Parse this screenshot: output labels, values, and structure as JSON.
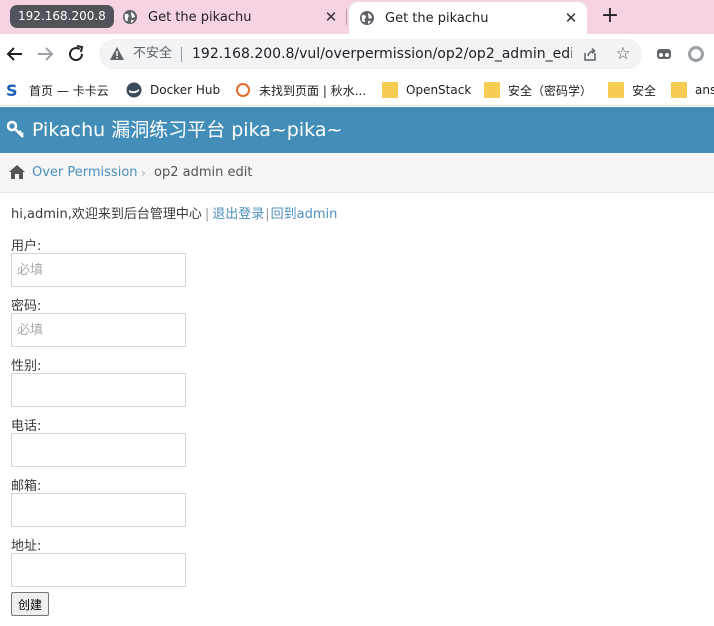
{
  "browser": {
    "tab_group_label": "192.168.200.8",
    "tabs": [
      {
        "title": "Get the pikachu",
        "active": false
      },
      {
        "title": "Get the pikachu",
        "active": true
      }
    ],
    "new_tab_icon": "plus-icon",
    "omnibox": {
      "security_label": "不安全",
      "url": "192.168.200.8/vul/overpermission/op2/op2_admin_edi..."
    },
    "bookmarks": [
      {
        "label": "首页 — 卡卡云",
        "icon": "s-logo-icon"
      },
      {
        "label": "Docker Hub",
        "icon": "docker-icon"
      },
      {
        "label": "未找到页面 | 秋水...",
        "icon": "circle-icon"
      },
      {
        "label": "OpenStack",
        "icon": "folder-icon"
      },
      {
        "label": "安全（密码学）",
        "icon": "folder-icon"
      },
      {
        "label": "安全",
        "icon": "folder-icon"
      },
      {
        "label": "ans",
        "icon": "folder-icon"
      }
    ]
  },
  "site": {
    "title": "Pikachu 漏洞练习平台 pika~pika~",
    "accent_color": "#438eb9"
  },
  "breadcrumb": {
    "parent": "Over Permission",
    "current": "op2 admin edit"
  },
  "main": {
    "welcome_text": "hi,admin,欢迎来到后台管理中心",
    "logout_link": "退出登录",
    "back_link": "回到admin",
    "fields": [
      {
        "label": "用户:",
        "placeholder": "必填",
        "value": ""
      },
      {
        "label": "密码:",
        "placeholder": "必填",
        "value": ""
      },
      {
        "label": "性别:",
        "placeholder": "",
        "value": ""
      },
      {
        "label": "电话:",
        "placeholder": "",
        "value": ""
      },
      {
        "label": "邮箱:",
        "placeholder": "",
        "value": ""
      },
      {
        "label": "地址:",
        "placeholder": "",
        "value": ""
      }
    ],
    "submit_label": "创建"
  }
}
